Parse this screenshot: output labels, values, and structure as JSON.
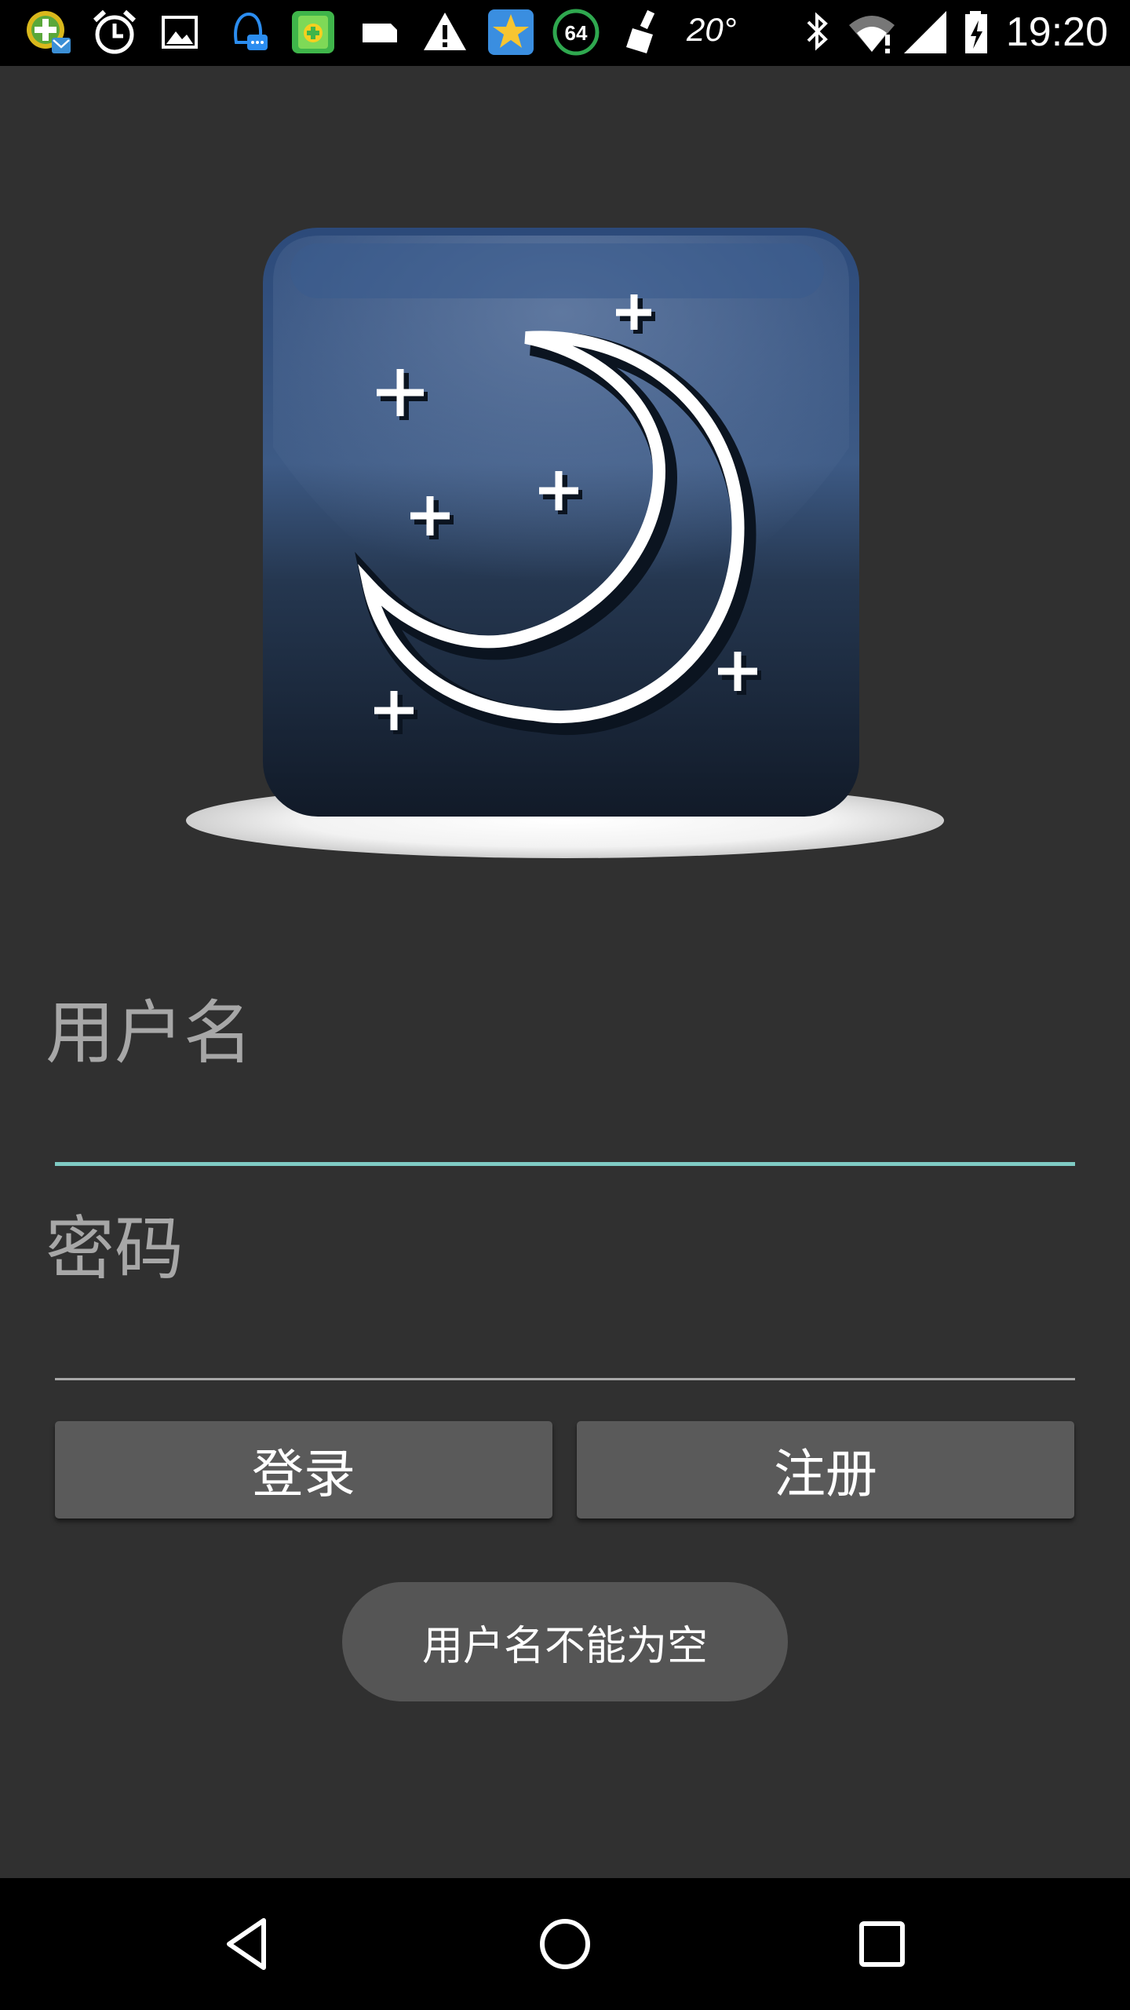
{
  "status_bar": {
    "time": "19:20",
    "weather_temp": "20°",
    "battery_badge": "64",
    "icons": [
      "app-notification-icon",
      "alarm-clock-icon",
      "gallery-icon",
      "qq-icon",
      "security-app-icon",
      "card-icon",
      "warning-icon",
      "star-app-icon",
      "battery-badge-icon",
      "cleaner-icon",
      "weather-icon",
      "bluetooth-icon",
      "wifi-icon",
      "signal-icon",
      "battery-icon"
    ]
  },
  "login_form": {
    "username_label": "用户名",
    "username_value": "",
    "password_label": "密码",
    "password_value": "",
    "login_button": "登录",
    "register_button": "注册"
  },
  "toast": {
    "message": "用户名不能为空"
  },
  "colors": {
    "background": "#303030",
    "accent_underline": "#7fcbc4",
    "button_bg": "#5a5a5a",
    "toast_bg": "#555555",
    "label_gray": "#a7a7a7"
  },
  "nav_bar": {
    "icons": [
      "back-icon",
      "home-icon",
      "recents-icon"
    ]
  }
}
